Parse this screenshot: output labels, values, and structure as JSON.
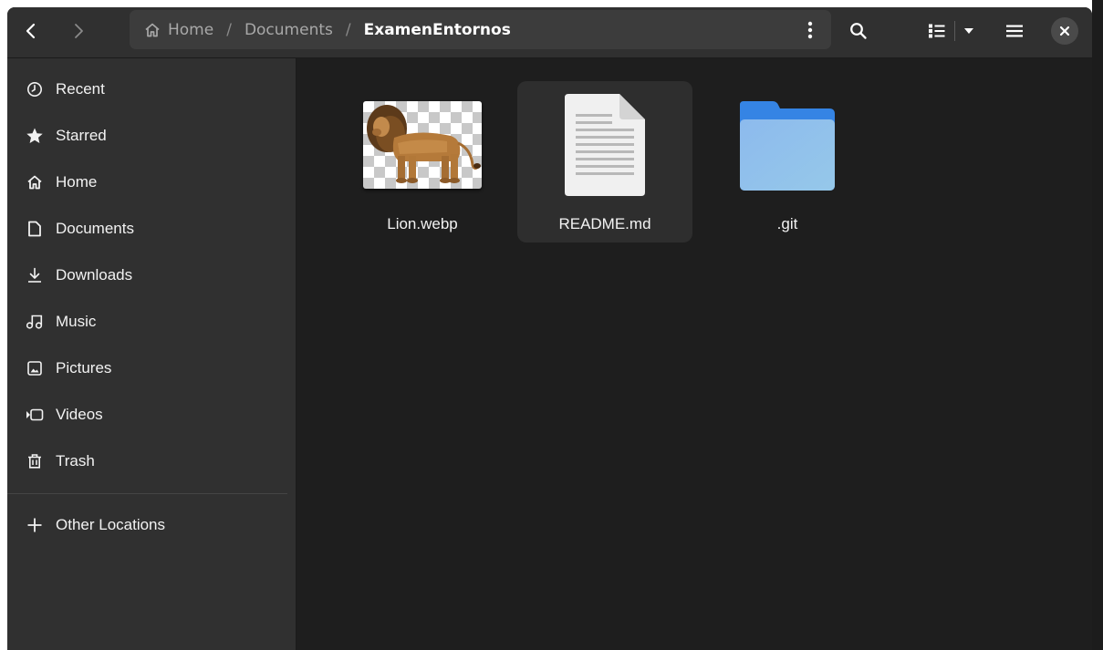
{
  "window": {
    "title": "ExamenEntornos",
    "colors": {
      "headerbar": "#303030",
      "sidebar": "#303030",
      "content": "#1e1e1e",
      "folder": "#7ab0e8"
    }
  },
  "headerbar": {
    "back_icon": "chevron-left-icon",
    "forward_icon": "chevron-right-icon",
    "path": {
      "home_icon": "home-icon",
      "crumbs": [
        "Home",
        "Documents",
        "ExamenEntornos"
      ],
      "separator": "/"
    },
    "menu_icon": "vertical-dots-icon",
    "search_icon": "search-icon",
    "view_icon": "list-view-icon",
    "view_dropdown_icon": "caret-down-icon",
    "hamburger_icon": "hamburger-icon",
    "close_icon": "close-icon"
  },
  "sidebar": {
    "items": [
      {
        "label": "Recent",
        "icon": "clock-icon"
      },
      {
        "label": "Starred",
        "icon": "star-icon"
      },
      {
        "label": "Home",
        "icon": "home-icon"
      },
      {
        "label": "Documents",
        "icon": "document-icon"
      },
      {
        "label": "Downloads",
        "icon": "download-icon"
      },
      {
        "label": "Music",
        "icon": "music-icon"
      },
      {
        "label": "Pictures",
        "icon": "picture-icon"
      },
      {
        "label": "Videos",
        "icon": "video-icon"
      },
      {
        "label": "Trash",
        "icon": "trash-icon"
      }
    ],
    "other": {
      "label": "Other Locations",
      "icon": "plus-icon"
    }
  },
  "files": [
    {
      "name": "Lion.webp",
      "icon": "image-thumbnail-icon",
      "selected": false
    },
    {
      "name": "README.md",
      "icon": "text-document-icon",
      "selected": true
    },
    {
      "name": ".git",
      "icon": "folder-icon",
      "selected": false
    }
  ]
}
